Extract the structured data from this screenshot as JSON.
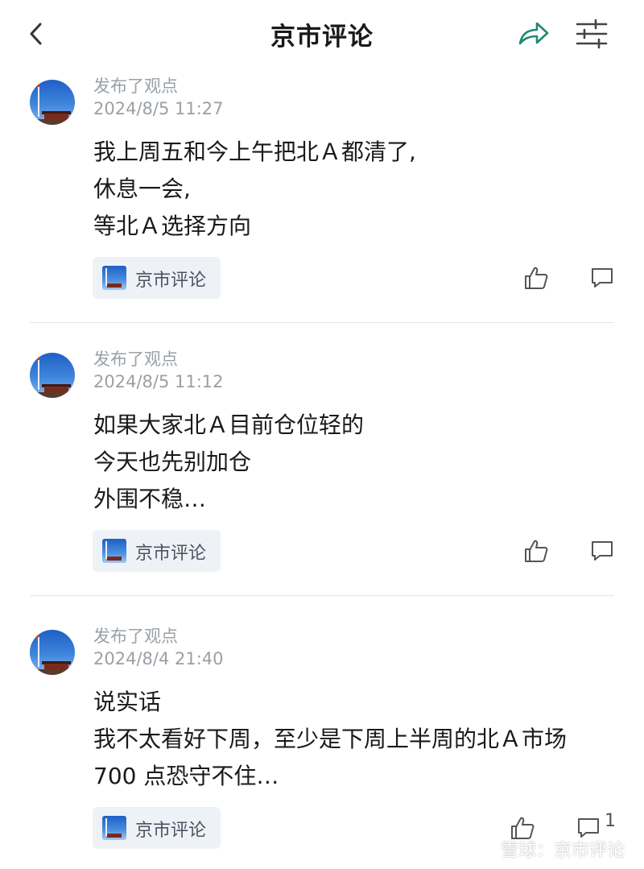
{
  "nav": {
    "title": "京市评论",
    "back_icon": "chevron-left-icon",
    "share_icon": "share-icon",
    "filter_icon": "sliders-icon",
    "accent_color": "#1f8a70"
  },
  "posts": [
    {
      "action": "发布了观点",
      "time": "2024/8/5 11:27",
      "lines": [
        "我上周五和今上午把北Ａ都清了,",
        "休息一会,",
        "等北Ａ选择方向"
      ],
      "tag_name": "京市评论",
      "comment_count": ""
    },
    {
      "action": "发布了观点",
      "time": "2024/8/5 11:12",
      "lines": [
        "如果大家北Ａ目前仓位轻的",
        "今天也先别加仓",
        "外围不稳…"
      ],
      "tag_name": "京市评论",
      "comment_count": ""
    },
    {
      "action": "发布了观点",
      "time": "2024/8/4 21:40",
      "lines": [
        "说实话",
        "我不太看好下周，至少是下周上半周的北Ａ市场",
        "700 点恐守不住…"
      ],
      "tag_name": "京市评论",
      "comment_count": "1"
    }
  ],
  "watermark": {
    "text": "雪球：京市评论",
    "icon": "snowball-logo-icon"
  }
}
